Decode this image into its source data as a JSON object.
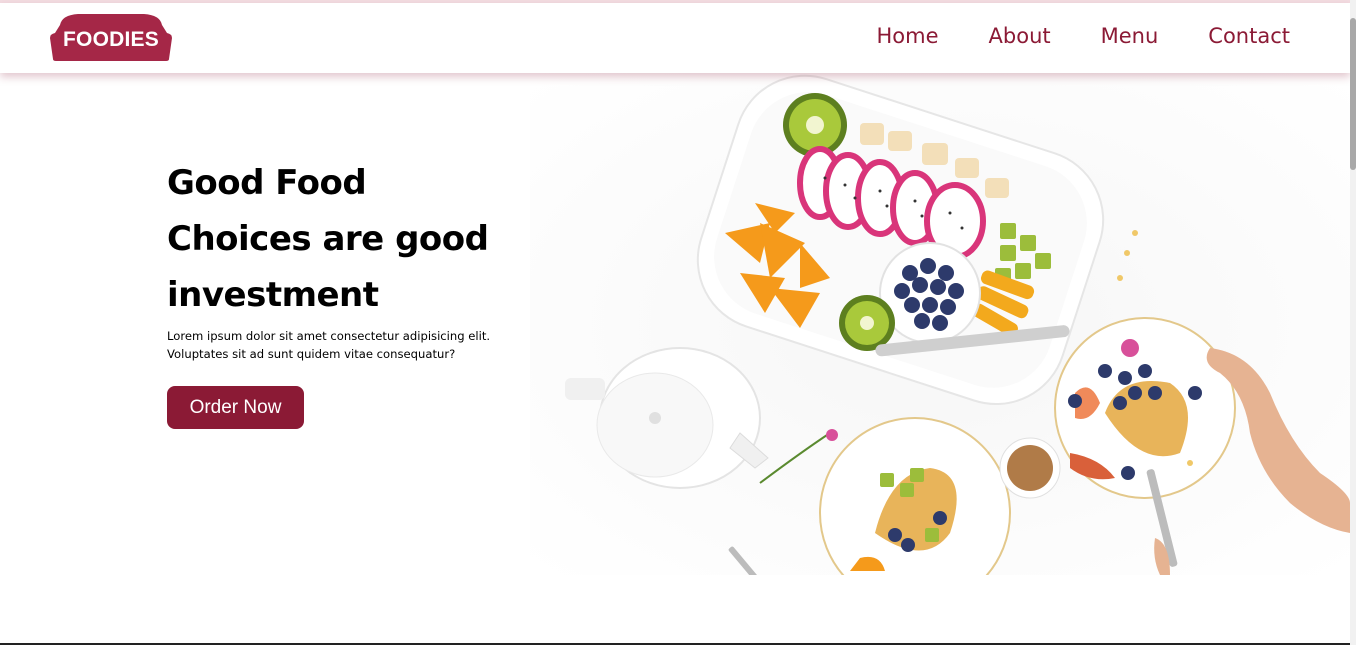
{
  "brand": {
    "logo_text": "FOODIES",
    "color": "#8b1a35"
  },
  "nav": {
    "items": [
      {
        "label": "Home"
      },
      {
        "label": "About"
      },
      {
        "label": "Menu"
      },
      {
        "label": "Contact"
      }
    ]
  },
  "hero": {
    "title_lines": [
      "Good Food",
      "Choices are good",
      "investment"
    ],
    "description_lines": [
      "Lorem ipsum dolor sit amet consectetur adipisicing elit.",
      "Voluptates sit ad sunt quidem vitae consequatur?"
    ],
    "cta_label": "Order Now",
    "image_subject": "fruit-platter-breakfast-photo"
  },
  "colors": {
    "accent": "#8b1a35",
    "text": "#000000",
    "background": "#ffffff"
  }
}
